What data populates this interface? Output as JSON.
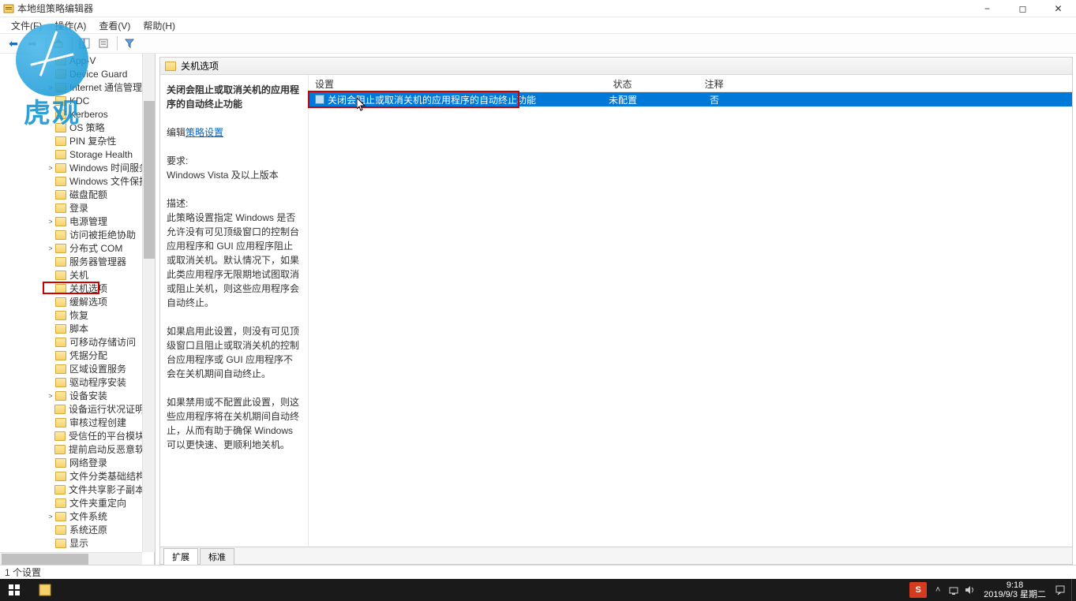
{
  "window": {
    "title": "本地组策略编辑器",
    "minimize": "−",
    "maximize": "◻",
    "close": "✕"
  },
  "menu": {
    "file": "文件(F)",
    "action": "操作(A)",
    "view": "查看(V)",
    "help": "帮助(H)"
  },
  "tree": [
    {
      "label": "App-V",
      "depth": 3,
      "exp": ">"
    },
    {
      "label": "Device Guard",
      "depth": 3,
      "exp": ""
    },
    {
      "label": "Internet 通信管理",
      "depth": 3,
      "exp": ">"
    },
    {
      "label": "KDC",
      "depth": 3,
      "exp": ""
    },
    {
      "label": "Kerberos",
      "depth": 3,
      "exp": ""
    },
    {
      "label": "OS 策略",
      "depth": 3,
      "exp": ""
    },
    {
      "label": "PIN 复杂性",
      "depth": 3,
      "exp": ""
    },
    {
      "label": "Storage Health",
      "depth": 3,
      "exp": ""
    },
    {
      "label": "Windows 时间服务",
      "depth": 3,
      "exp": ">"
    },
    {
      "label": "Windows 文件保护",
      "depth": 3,
      "exp": ""
    },
    {
      "label": "磁盘配额",
      "depth": 3,
      "exp": ""
    },
    {
      "label": "登录",
      "depth": 3,
      "exp": ""
    },
    {
      "label": "电源管理",
      "depth": 3,
      "exp": ">"
    },
    {
      "label": "访问被拒绝协助",
      "depth": 3,
      "exp": ""
    },
    {
      "label": "分布式 COM",
      "depth": 3,
      "exp": ">"
    },
    {
      "label": "服务器管理器",
      "depth": 3,
      "exp": ""
    },
    {
      "label": "关机",
      "depth": 3,
      "exp": ""
    },
    {
      "label": "关机选项",
      "depth": 3,
      "exp": "",
      "selected": true
    },
    {
      "label": "缓解选项",
      "depth": 3,
      "exp": ""
    },
    {
      "label": "恢复",
      "depth": 3,
      "exp": ""
    },
    {
      "label": "脚本",
      "depth": 3,
      "exp": ""
    },
    {
      "label": "可移动存储访问",
      "depth": 3,
      "exp": ""
    },
    {
      "label": "凭据分配",
      "depth": 3,
      "exp": ""
    },
    {
      "label": "区域设置服务",
      "depth": 3,
      "exp": ""
    },
    {
      "label": "驱动程序安装",
      "depth": 3,
      "exp": ""
    },
    {
      "label": "设备安装",
      "depth": 3,
      "exp": ">"
    },
    {
      "label": "设备运行状况证明服",
      "depth": 3,
      "exp": ""
    },
    {
      "label": "审核过程创建",
      "depth": 3,
      "exp": ""
    },
    {
      "label": "受信任的平台模块服",
      "depth": 3,
      "exp": ""
    },
    {
      "label": "提前启动反恶意软件",
      "depth": 3,
      "exp": ""
    },
    {
      "label": "网络登录",
      "depth": 3,
      "exp": ""
    },
    {
      "label": "文件分类基础结构",
      "depth": 3,
      "exp": ""
    },
    {
      "label": "文件共享影子副本提",
      "depth": 3,
      "exp": ""
    },
    {
      "label": "文件夹重定向",
      "depth": 3,
      "exp": ""
    },
    {
      "label": "文件系统",
      "depth": 3,
      "exp": ">"
    },
    {
      "label": "系统还原",
      "depth": 3,
      "exp": ""
    },
    {
      "label": "显示",
      "depth": 3,
      "exp": ""
    }
  ],
  "right_header": "关机选项",
  "desc": {
    "title": "关闭会阻止或取消关机的应用程序的自动终止功能",
    "edit_prefix": "编辑",
    "edit_link": "策略设置",
    "req_label": "要求:",
    "req_value": "Windows Vista 及以上版本",
    "desc_label": "描述:",
    "p1": "此策略设置指定 Windows 是否允许没有可见顶级窗口的控制台应用程序和 GUI 应用程序阻止或取消关机。默认情况下，如果此类应用程序无限期地试图取消或阻止关机，则这些应用程序会自动终止。",
    "p2": "如果启用此设置，则没有可见顶级窗口且阻止或取消关机的控制台应用程序或 GUI 应用程序不会在关机期间自动终止。",
    "p3": "如果禁用或不配置此设置，则这些应用程序将在关机期间自动终止，从而有助于确保 Windows 可以更快速、更顺利地关机。"
  },
  "list": {
    "col_setting": "设置",
    "col_status": "状态",
    "col_note": "注释",
    "rows": [
      {
        "name": "关闭会阻止或取消关机的应用程序的自动终止功能",
        "status": "未配置",
        "note": "否",
        "selected": true
      }
    ]
  },
  "tabs": {
    "extended": "扩展",
    "standard": "标准"
  },
  "status": "1 个设置",
  "taskbar": {
    "ime": "S",
    "time": "9:18",
    "date": "2019/9/3 星期二"
  },
  "watermark": "虎观"
}
